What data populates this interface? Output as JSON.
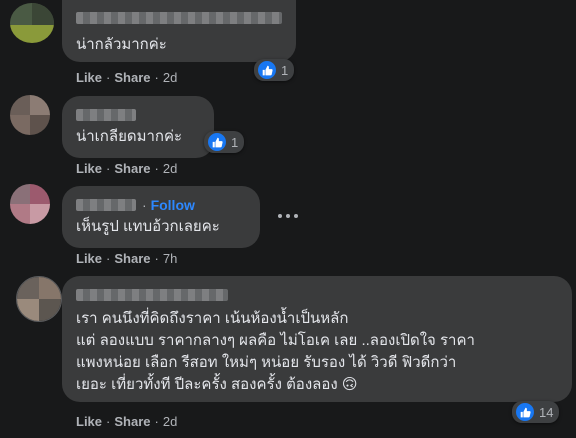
{
  "actions": {
    "like": "Like",
    "share": "Share",
    "sep": "·"
  },
  "comments": [
    {
      "text": "น่ากลัวมากค่ะ",
      "time": "2d",
      "reactions": "1"
    },
    {
      "text": "น่าเกลียดมากค่ะ",
      "time": "2d",
      "reactions": "1"
    },
    {
      "text": "เห็นรูป แทบอ้วกเลยคะ",
      "time": "7h",
      "follow": "Follow",
      "follow_sep": "·"
    },
    {
      "lines": [
        "เรา คนนึงที่คิดถึงราคา เน้นห้องน้ำเป็นหลัก",
        "แต่ ลองแบบ ราคากลางๆ ผลคือ ไม่โอเค เลย ..ลองเปิดใจ ราคา",
        "แพงหน่อย เลือก รีสอท ใหม่ๆ หน่อย รับรอง ได้ วิวดี ฟิวดีกว่า",
        "เยอะ เที่ยวทั้งที ปีละครั้ง สองครั้ง ต้องลอง 🙃"
      ],
      "time": "2d",
      "reactions": "14"
    }
  ],
  "colors": {
    "background": "#18191a",
    "bubble": "#3a3b3c",
    "like_blue": "#1877f2",
    "follow_blue": "#2d88ff"
  },
  "icons": {
    "reaction": "thumbs-up-icon",
    "more": "more-horizontal-icon"
  }
}
